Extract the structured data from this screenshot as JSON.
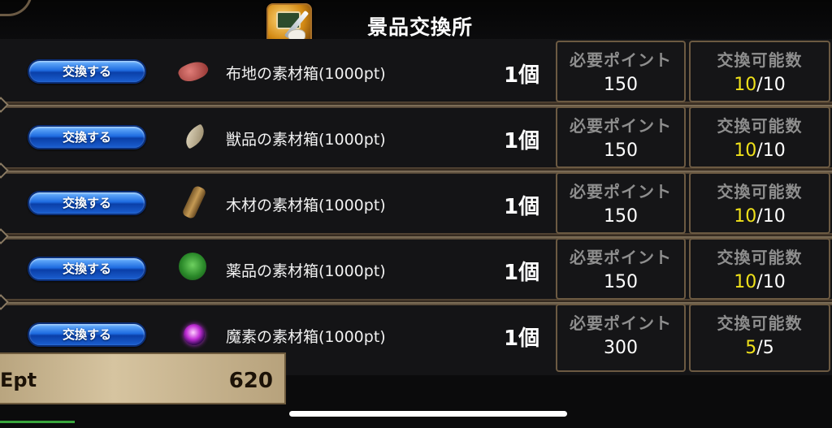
{
  "header": {
    "title": "景品交換所",
    "icon": "exchange-shop-icon"
  },
  "rows": [
    {
      "button_label": "交換する",
      "icon": "cloth-material-icon",
      "name": "布地の素材箱(1000pt)",
      "qty": "1個",
      "points_label": "必要ポイント",
      "points_value": "150",
      "avail_label": "交換可能数",
      "avail_current": "10",
      "avail_total": "/10"
    },
    {
      "button_label": "交換する",
      "icon": "fang-material-icon",
      "name": "獣品の素材箱(1000pt)",
      "qty": "1個",
      "points_label": "必要ポイント",
      "points_value": "150",
      "avail_label": "交換可能数",
      "avail_current": "10",
      "avail_total": "/10"
    },
    {
      "button_label": "交換する",
      "icon": "wood-material-icon",
      "name": "木材の素材箱(1000pt)",
      "qty": "1個",
      "points_label": "必要ポイント",
      "points_value": "150",
      "avail_label": "交換可能数",
      "avail_current": "10",
      "avail_total": "/10"
    },
    {
      "button_label": "交換する",
      "icon": "herb-material-icon",
      "name": "薬品の素材箱(1000pt)",
      "qty": "1個",
      "points_label": "必要ポイント",
      "points_value": "150",
      "avail_label": "交換可能数",
      "avail_current": "10",
      "avail_total": "/10"
    },
    {
      "button_label": "交換する",
      "icon": "magic-orb-icon",
      "name": "魔素の素材箱(1000pt)",
      "qty": "1個",
      "points_label": "必要ポイント",
      "points_value": "300",
      "avail_label": "交換可能数",
      "avail_current": "5",
      "avail_total": "/5"
    }
  ],
  "status": {
    "label": "Ept",
    "value": "620"
  },
  "colors": {
    "accent_yellow": "#f0e11a",
    "button_blue": "#1e6be0",
    "panel_border": "#6c5a42"
  }
}
